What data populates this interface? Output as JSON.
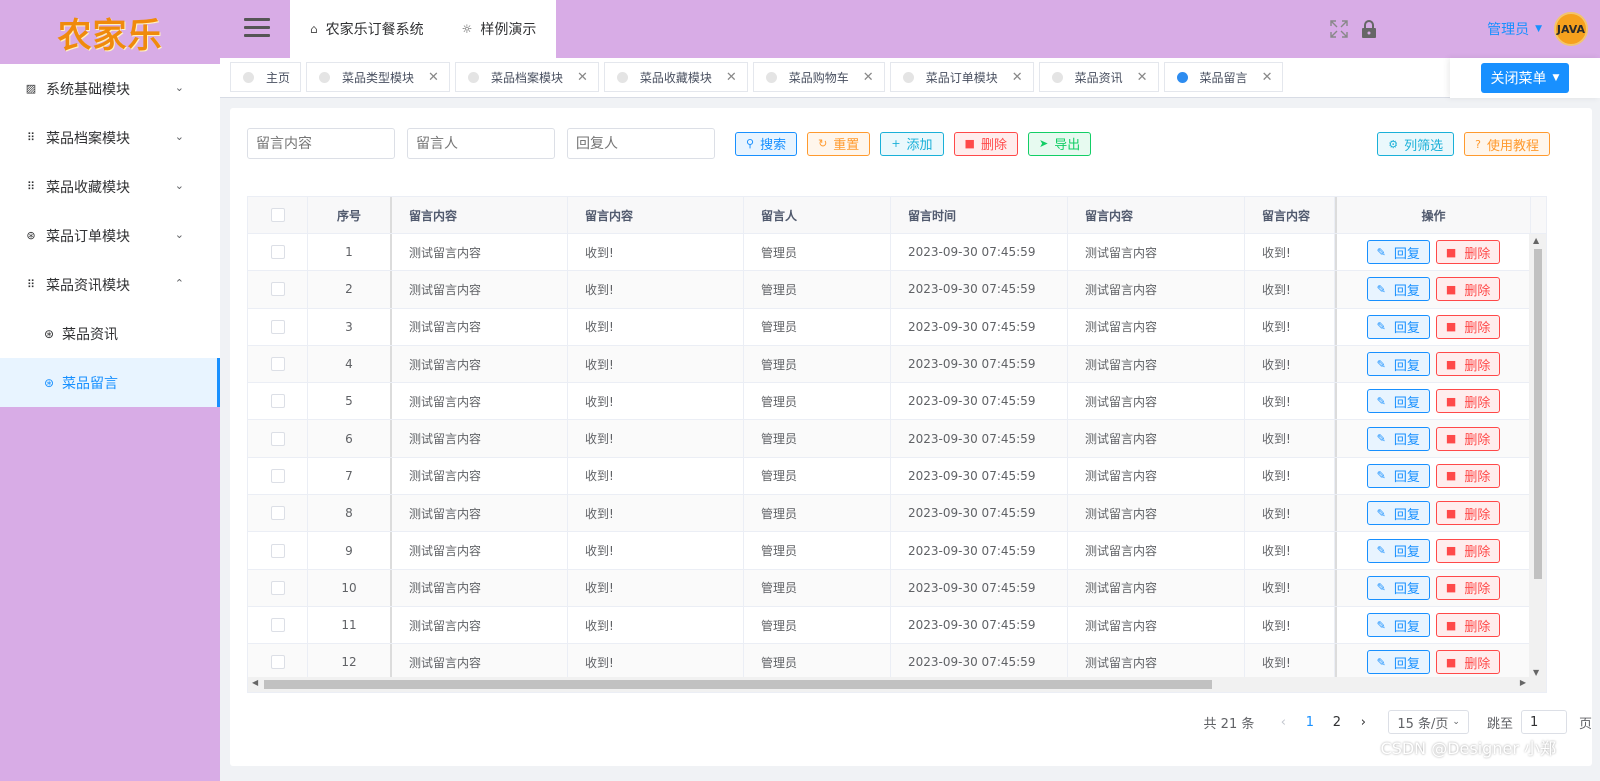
{
  "logo": "农家乐",
  "sidebar": {
    "items": [
      {
        "label": "系统基础模块",
        "icon": "chart-icon",
        "glyph": "▨",
        "chevron": "⌄"
      },
      {
        "label": "菜品档案模块",
        "icon": "grid-icon",
        "glyph": "⠿",
        "chevron": "⌄"
      },
      {
        "label": "菜品收藏模块",
        "icon": "grid-icon",
        "glyph": "⠿",
        "chevron": "⌄"
      },
      {
        "label": "菜品订单模块",
        "icon": "ring-icon",
        "glyph": "⊛",
        "chevron": "⌄"
      },
      {
        "label": "菜品资讯模块",
        "icon": "grid-icon",
        "glyph": "⠿",
        "chevron": "⌃"
      }
    ],
    "sub_items": [
      {
        "label": "菜品资讯",
        "glyph": "⊛",
        "active": false
      },
      {
        "label": "菜品留言",
        "glyph": "⊛",
        "active": true
      }
    ]
  },
  "header": {
    "top_tabs": [
      {
        "label": "农家乐订餐系统",
        "icon": "home-icon",
        "glyph": "⌂"
      },
      {
        "label": "样例演示",
        "icon": "bulb-icon",
        "glyph": "☼"
      }
    ],
    "user": "管理员",
    "avatar_text": "JAVA"
  },
  "tags": [
    {
      "label": "主页",
      "closable": false,
      "active": false
    },
    {
      "label": "菜品类型模块",
      "closable": true,
      "active": false
    },
    {
      "label": "菜品档案模块",
      "closable": true,
      "active": false
    },
    {
      "label": "菜品收藏模块",
      "closable": true,
      "active": false
    },
    {
      "label": "菜品购物车",
      "closable": true,
      "active": false
    },
    {
      "label": "菜品订单模块",
      "closable": true,
      "active": false
    },
    {
      "label": "菜品资讯",
      "closable": true,
      "active": false
    },
    {
      "label": "菜品留言",
      "closable": true,
      "active": true
    }
  ],
  "close_menu": "关闭菜单",
  "search": {
    "content_placeholder": "留言内容",
    "user_placeholder": "留言人",
    "reply_placeholder": "回复人"
  },
  "buttons": {
    "search": "搜索",
    "reset": "重置",
    "add": "添加",
    "delete": "删除",
    "export": "导出",
    "filter": "列筛选",
    "tutorial": "使用教程"
  },
  "table": {
    "headers": [
      "序号",
      "留言内容",
      "留言内容",
      "留言人",
      "留言时间",
      "留言内容",
      "留言内容",
      "操作"
    ],
    "rows": [
      [
        "1",
        "测试留言内容",
        "收到!",
        "管理员",
        "2023-09-30 07:45:59",
        "测试留言内容",
        "收到!"
      ],
      [
        "2",
        "测试留言内容",
        "收到!",
        "管理员",
        "2023-09-30 07:45:59",
        "测试留言内容",
        "收到!"
      ],
      [
        "3",
        "测试留言内容",
        "收到!",
        "管理员",
        "2023-09-30 07:45:59",
        "测试留言内容",
        "收到!"
      ],
      [
        "4",
        "测试留言内容",
        "收到!",
        "管理员",
        "2023-09-30 07:45:59",
        "测试留言内容",
        "收到!"
      ],
      [
        "5",
        "测试留言内容",
        "收到!",
        "管理员",
        "2023-09-30 07:45:59",
        "测试留言内容",
        "收到!"
      ],
      [
        "6",
        "测试留言内容",
        "收到!",
        "管理员",
        "2023-09-30 07:45:59",
        "测试留言内容",
        "收到!"
      ],
      [
        "7",
        "测试留言内容",
        "收到!",
        "管理员",
        "2023-09-30 07:45:59",
        "测试留言内容",
        "收到!"
      ],
      [
        "8",
        "测试留言内容",
        "收到!",
        "管理员",
        "2023-09-30 07:45:59",
        "测试留言内容",
        "收到!"
      ],
      [
        "9",
        "测试留言内容",
        "收到!",
        "管理员",
        "2023-09-30 07:45:59",
        "测试留言内容",
        "收到!"
      ],
      [
        "10",
        "测试留言内容",
        "收到!",
        "管理员",
        "2023-09-30 07:45:59",
        "测试留言内容",
        "收到!"
      ],
      [
        "11",
        "测试留言内容",
        "收到!",
        "管理员",
        "2023-09-30 07:45:59",
        "测试留言内容",
        "收到!"
      ],
      [
        "12",
        "测试留言内容",
        "收到!",
        "管理员",
        "2023-09-30 07:45:59",
        "测试留言内容",
        "收到!"
      ]
    ],
    "row_actions": {
      "reply": "回复",
      "delete": "删除"
    }
  },
  "pagination": {
    "total": "共 21 条",
    "pages": [
      "1",
      "2"
    ],
    "current": "1",
    "page_size": "15 条/页",
    "jump_label": "跳至",
    "jump_value": "1",
    "page_suffix": "页"
  },
  "watermark": "CSDN @Designer 小郑",
  "colors": {
    "sidebar_bg": "#d8ace6",
    "accent": "#1890ff",
    "danger": "#ff4949",
    "warning": "#ff9a2e",
    "success": "#13ce66",
    "logo": "#f08a0c"
  }
}
